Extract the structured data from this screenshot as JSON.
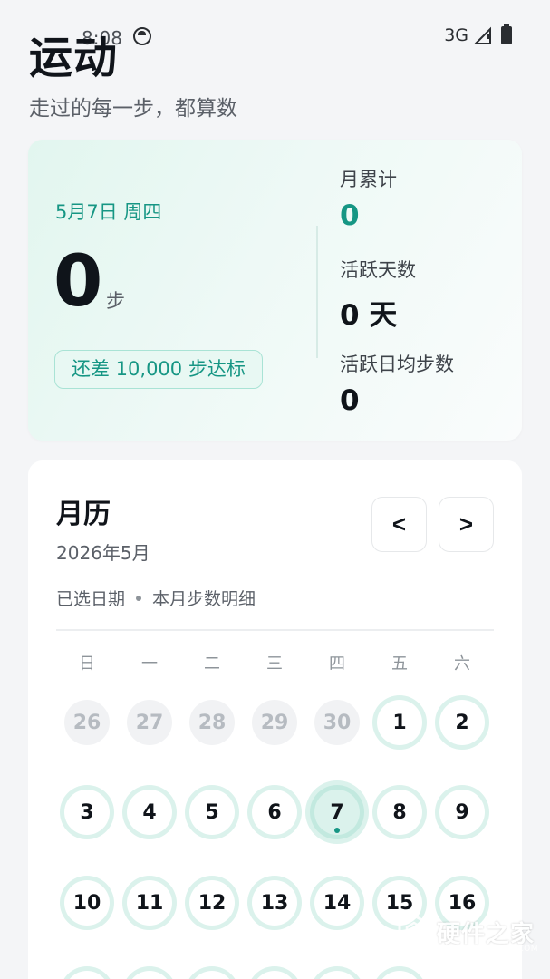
{
  "status_bar": {
    "time": "8:08",
    "network": "3G"
  },
  "header": {
    "title": "运动",
    "subtitle": "走过的每一步，都算数"
  },
  "summary": {
    "date": "5月7日 周四",
    "steps": "0",
    "steps_unit": "步",
    "goal_text": "还差 10,000 步达标",
    "month_total_label": "月累计",
    "month_total_value": "0",
    "active_days_label": "活跃天数",
    "active_days_value": "0 天",
    "avg_steps_label": "活跃日均步数",
    "avg_steps_value": "0"
  },
  "calendar": {
    "title": "月历",
    "month": "2026年5月",
    "prev_label": "<",
    "next_label": ">",
    "hint_left": "已选日期",
    "hint_right": "本月步数明细",
    "weekdays": [
      "日",
      "一",
      "二",
      "三",
      "四",
      "五",
      "六"
    ],
    "days": [
      "26",
      "27",
      "28",
      "29",
      "30",
      "1",
      "2",
      "3",
      "4",
      "5",
      "6",
      "7",
      "8",
      "9",
      "10",
      "11",
      "12",
      "13",
      "14",
      "15",
      "16"
    ]
  },
  "watermark": {
    "text": "硬件之家",
    "sub": "YING JIAN ZHI JIA.COM"
  },
  "colors": {
    "accent": "#169684",
    "ring": "#dbf2ec",
    "background": "#f4f5f7"
  }
}
